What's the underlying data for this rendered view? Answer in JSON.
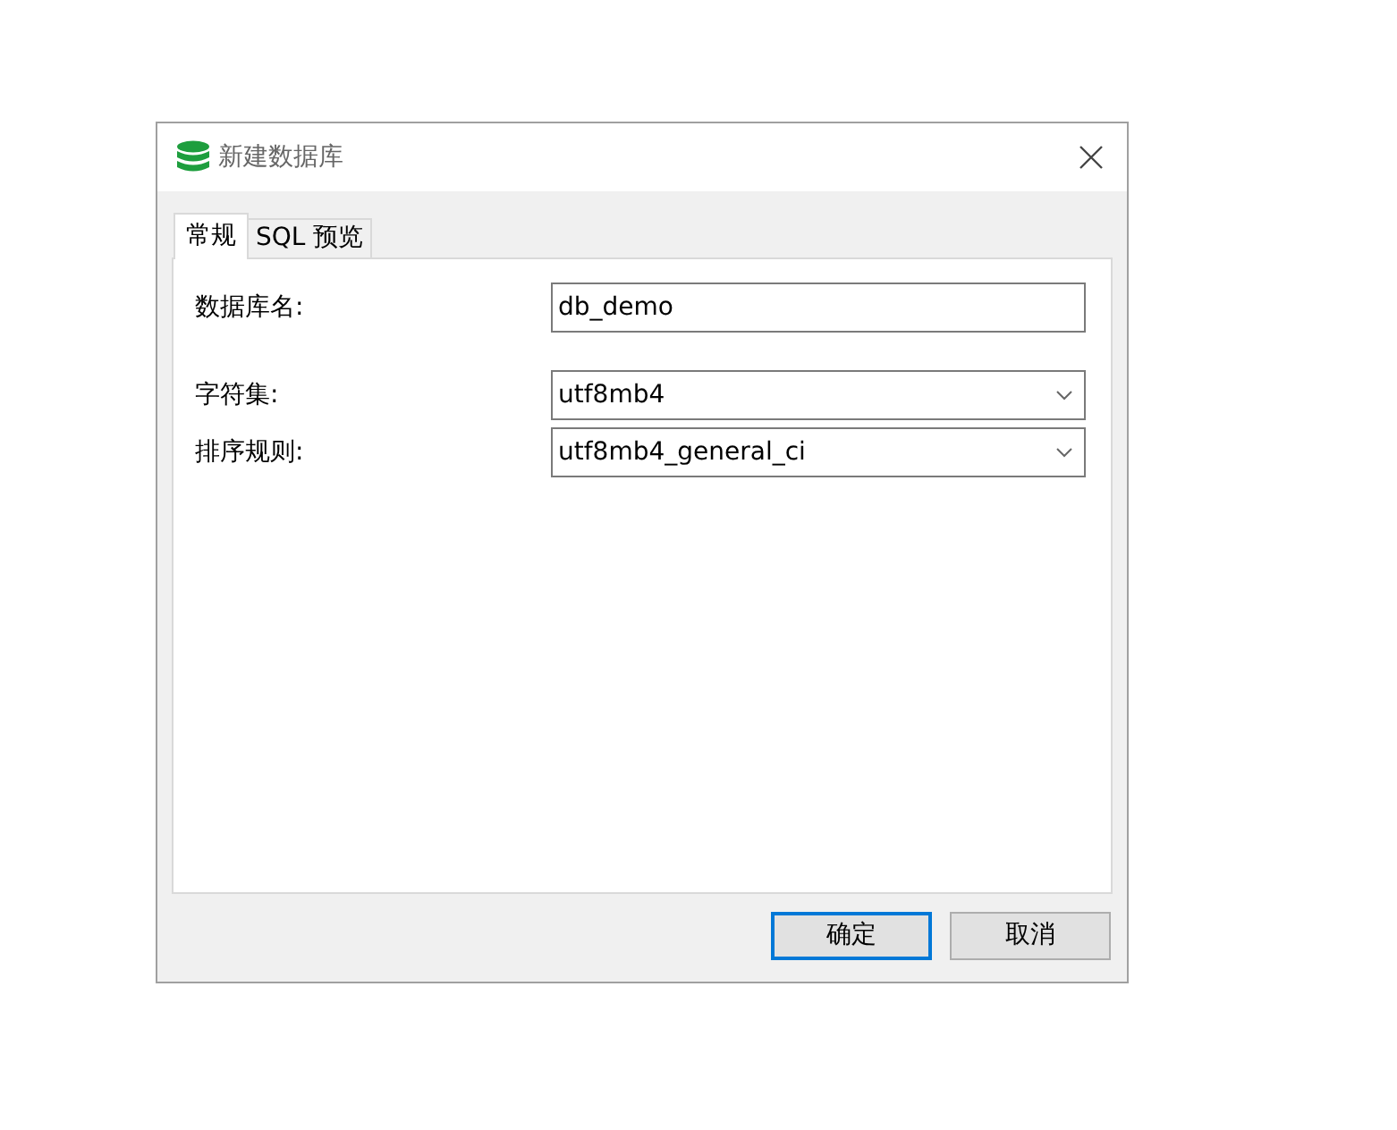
{
  "window": {
    "title": "新建数据库"
  },
  "tabs": [
    {
      "label": "常规",
      "selected": true
    },
    {
      "label": "SQL 预览",
      "selected": false
    }
  ],
  "fields": [
    {
      "label": "数据库名:",
      "kind": "text",
      "value": "db_demo"
    },
    {
      "label": "字符集:",
      "kind": "select",
      "value": "utf8mb4"
    },
    {
      "label": "排序规则:",
      "kind": "select",
      "value": "utf8mb4_general_ci"
    }
  ],
  "buttons": [
    {
      "label": "确定",
      "default": true
    },
    {
      "label": "取消",
      "default": false
    }
  ]
}
